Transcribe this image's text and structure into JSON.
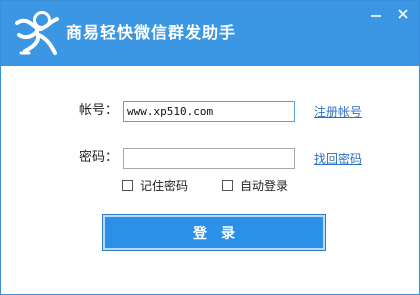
{
  "window": {
    "title": "商易轻快微信群发助手",
    "accent_color": "#3b96e4",
    "logo_icon": "running-figure-icon",
    "controls": {
      "minimize_icon": "minimize-icon",
      "close_icon": "close-icon"
    }
  },
  "form": {
    "account_label": "帐号：",
    "account_value": "www.xp510.com",
    "password_label": "密码：",
    "password_value": "",
    "register_link": "注册帐号",
    "recover_link": "找回密码",
    "remember_label": "记住密码",
    "remember_checked": false,
    "autologin_label": "自动登录",
    "autologin_checked": false,
    "login_button": "登录"
  }
}
